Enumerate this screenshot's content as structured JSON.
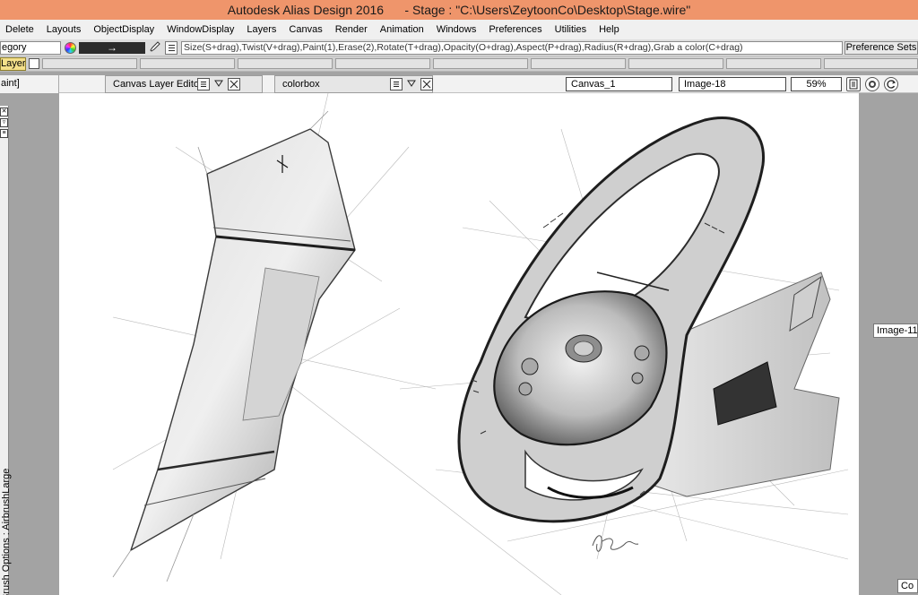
{
  "window": {
    "title": "Autodesk Alias Design 2016      - Stage : \"C:\\Users\\ZeytoonCo\\Desktop\\Stage.wire\""
  },
  "menu": [
    "Delete",
    "Layouts",
    "ObjectDisplay",
    "WindowDisplay",
    "Layers",
    "Canvas",
    "Render",
    "Animation",
    "Windows",
    "Preferences",
    "Utilities",
    "Help"
  ],
  "toolbar": {
    "category": "egory",
    "stroke_arrow": "→",
    "hint": "Size(S+drag),Twist(V+drag),Paint(1),Erase(2),Rotate(T+drag),Opacity(O+drag),Aspect(P+drag),Radius(R+drag),Grab a color(C+drag)",
    "preference_sets": "Preference Sets"
  },
  "layerbar": {
    "active_layer": "Layer"
  },
  "header": {
    "paint_label": "aint]",
    "canvas_layer_editor": "Canvas Layer Editor",
    "colorbox": "colorbox",
    "canvas_name": "Canvas_1",
    "image_name": "Image-18",
    "zoom": "59%"
  },
  "left_panel": {
    "brush_options": "Brush Options : AirbrushLarge"
  },
  "right_panel": {
    "image_tag": "Image-11",
    "bottom_tag": "Co"
  },
  "colors": {
    "titlebar": "#ef956b",
    "layer_tab": "#f4e08a",
    "panel_bg": "#a3a3a3"
  },
  "icons": [
    "color-wheel-icon",
    "eyedropper-icon",
    "list-icon",
    "menu-icon",
    "chevron-down-icon",
    "close-icon",
    "canvas-settings-icon",
    "snapshot-icon",
    "refresh-icon"
  ]
}
